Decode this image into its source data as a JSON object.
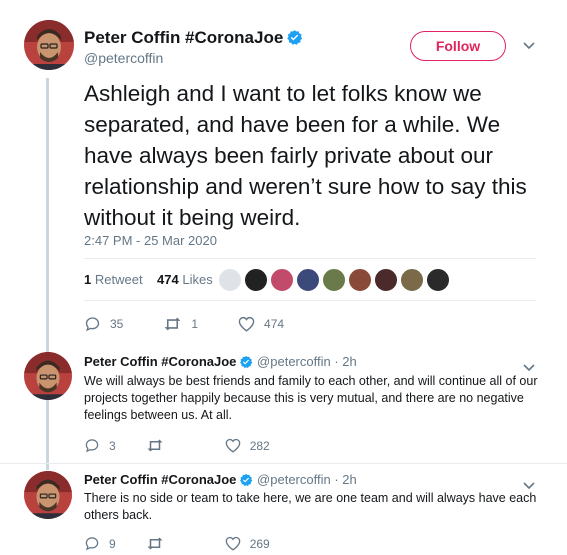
{
  "main_tweet": {
    "author_name": "Peter Coffin #CoronaJoe",
    "author_handle": "@petercoffin",
    "follow_label": "Follow",
    "text": "Ashleigh and I want to let folks know we separated, and have been for a while. We have always been fairly private about our relationship and weren’t sure how to say this without it being weird.",
    "timestamp": "2:47 PM - 25 Mar 2020",
    "retweets_count": "1",
    "retweets_label": "Retweet",
    "likes_count": "474",
    "likes_label": "Likes",
    "reply_count": "35",
    "retweet_count_action": "1",
    "like_count_action": "474"
  },
  "replies": [
    {
      "author_name": "Peter Coffin #CoronaJoe",
      "handle_time": "@petercoffin · 2h",
      "text": "We will always be best friends and family to each other, and will continue all of our projects together happily because this is very mutual, and there are no negative feelings between us. At all.",
      "reply_count": "3",
      "retweet_count": "",
      "like_count": "282"
    },
    {
      "author_name": "Peter Coffin #CoronaJoe",
      "handle_time": "@petercoffin · 2h",
      "text": "There is no side or team to take here, we are one team and will always have each others back.",
      "reply_count": "9",
      "retweet_count": "",
      "like_count": "269"
    }
  ],
  "colors": {
    "accent": "#e0245e",
    "verified": "#1da1f2",
    "muted": "#657786",
    "thread_line": "#ccd6dd"
  },
  "icons": [
    "verified-badge-icon",
    "chevron-down-icon",
    "reply-icon",
    "retweet-icon",
    "like-icon"
  ]
}
